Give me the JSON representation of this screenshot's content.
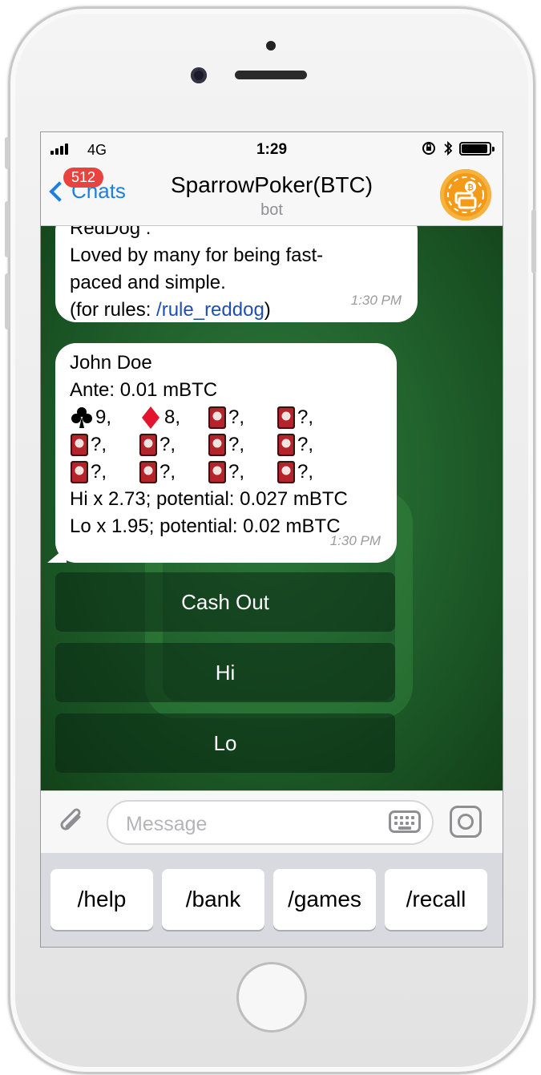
{
  "status_bar": {
    "network": "4G",
    "time": "1:29"
  },
  "header": {
    "back_label": "Chats",
    "unread_badge": "512",
    "title": "SparrowPoker(BTC)",
    "subtitle": "bot"
  },
  "messages": [
    {
      "lines": [
        "RedDog :",
        "Loved by many for being fast-",
        "paced and simple."
      ],
      "rules_prefix": "(for rules: ",
      "rules_link": "/rule_reddog",
      "rules_suffix": ")",
      "time": "1:30 PM"
    },
    {
      "lines": [
        "John Doe",
        "Ante: 0.01 mBTC"
      ],
      "card_rows": [
        [
          {
            "suit": "clubs",
            "label": "9,"
          },
          {
            "suit": "diamonds",
            "label": "8,"
          },
          {
            "suit": "hidden",
            "label": "?,"
          },
          {
            "suit": "hidden",
            "label": "?,"
          }
        ],
        [
          {
            "suit": "hidden",
            "label": "?,"
          },
          {
            "suit": "hidden",
            "label": "?,"
          },
          {
            "suit": "hidden",
            "label": "?,"
          },
          {
            "suit": "hidden",
            "label": "?,"
          }
        ],
        [
          {
            "suit": "hidden",
            "label": "?,"
          },
          {
            "suit": "hidden",
            "label": "?,"
          },
          {
            "suit": "hidden",
            "label": "?,"
          },
          {
            "suit": "hidden",
            "label": "?,"
          }
        ]
      ],
      "footer_lines": [
        "Hi x 2.73; potential: 0.027 mBTC",
        "Lo x 1.95; potential: 0.02 mBTC"
      ],
      "time": "1:30 PM"
    }
  ],
  "inline_buttons": [
    "Cash Out",
    "Hi",
    "Lo"
  ],
  "input": {
    "placeholder": "Message"
  },
  "commands": [
    "/help",
    "/bank",
    "/games",
    "/recall"
  ],
  "colors": {
    "accent": "#1f7fde",
    "badge": "#e8433f",
    "chat_bg": "#1f5e2b",
    "avatar": "#f39a18"
  }
}
